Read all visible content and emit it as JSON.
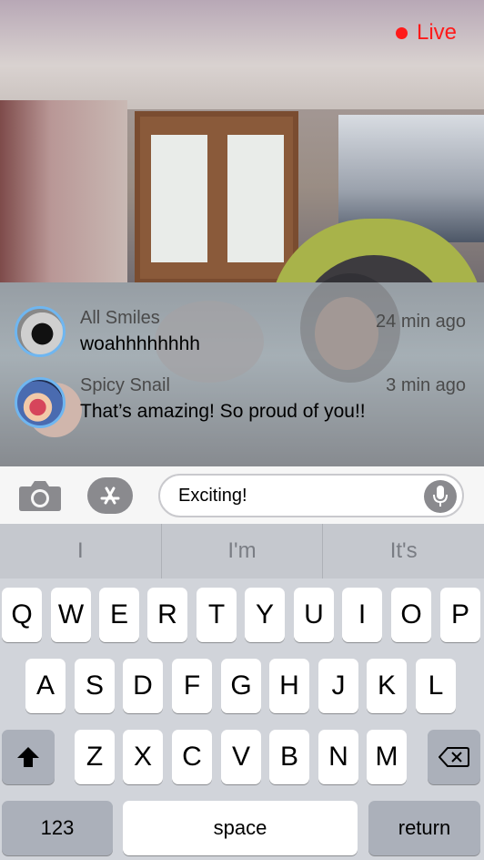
{
  "live_label": "Live",
  "comments": [
    {
      "name": "All Smiles",
      "text": "woahhhhhhhh",
      "time": "24 min ago"
    },
    {
      "name": "Spicy Snail",
      "text": "That’s amazing! So proud of you!!",
      "time": "3 min ago"
    }
  ],
  "input": {
    "value": "Exciting!"
  },
  "icons": {
    "camera": "camera-icon",
    "apps": "app-store-icon",
    "mic": "microphone-icon"
  },
  "suggestions": [
    "I",
    "I'm",
    "It's"
  ],
  "keyboard": {
    "row1": [
      "Q",
      "W",
      "E",
      "R",
      "T",
      "Y",
      "U",
      "I",
      "O",
      "P"
    ],
    "row2": [
      "A",
      "S",
      "D",
      "F",
      "G",
      "H",
      "J",
      "K",
      "L"
    ],
    "row3": [
      "Z",
      "X",
      "C",
      "V",
      "B",
      "N",
      "M"
    ],
    "numbers_label": "123",
    "space_label": "space",
    "return_label": "return"
  },
  "colors": {
    "live": "#ff1a1a",
    "avatar_ring": "#6fb6f0"
  }
}
